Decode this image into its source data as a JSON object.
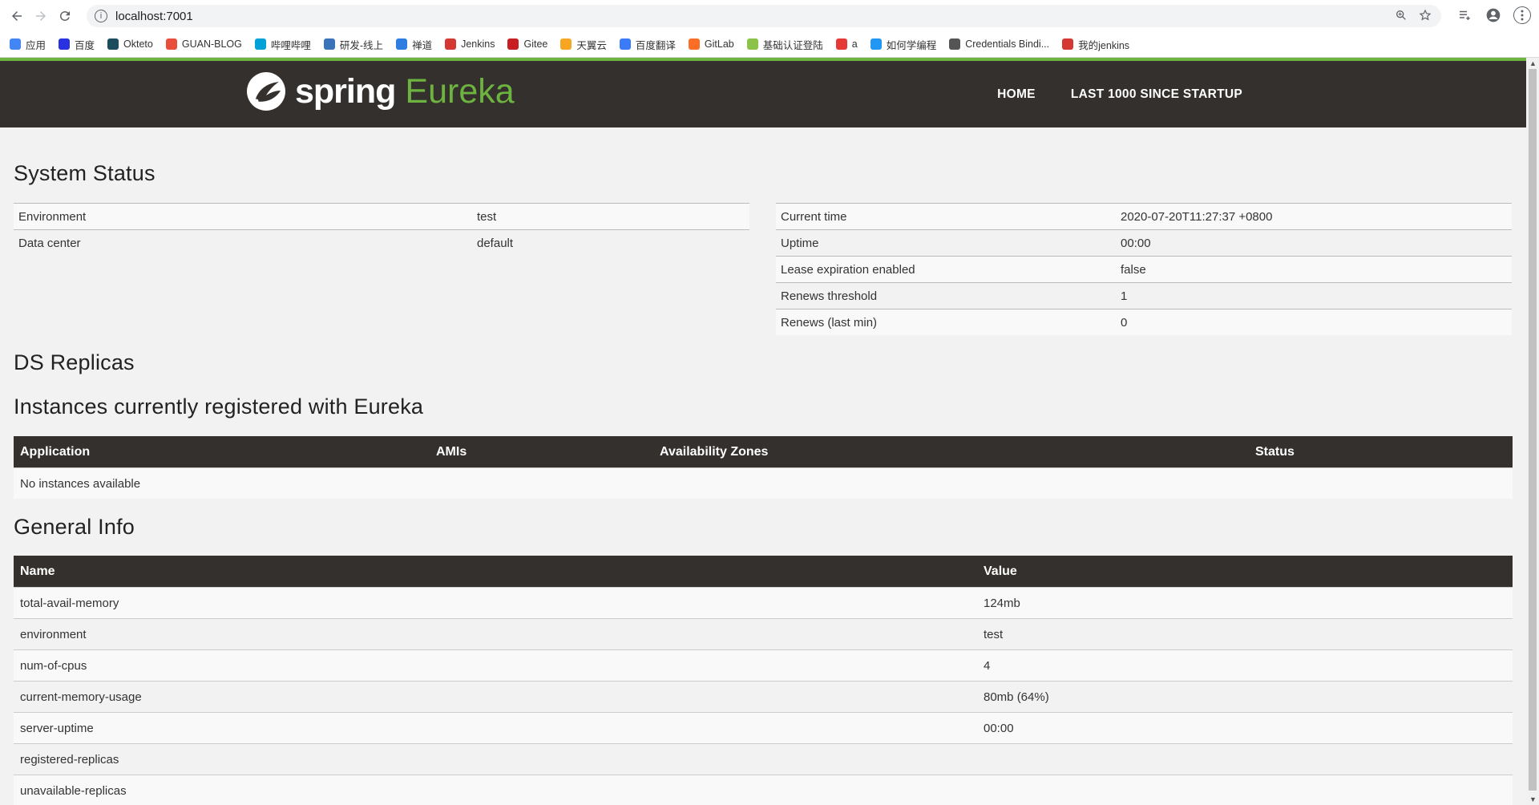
{
  "browser": {
    "url": "localhost:7001",
    "bookmarks": [
      {
        "label": "应用",
        "color": "#4285f4"
      },
      {
        "label": "百度",
        "color": "#2932e1"
      },
      {
        "label": "Okteto",
        "color": "#1b4d5c"
      },
      {
        "label": "GUAN-BLOG",
        "color": "#e94e3c"
      },
      {
        "label": "哔哩哔哩",
        "color": "#00a1d6"
      },
      {
        "label": "研发-线上",
        "color": "#3b73b9"
      },
      {
        "label": "禅道",
        "color": "#2e7de1"
      },
      {
        "label": "Jenkins",
        "color": "#d33833"
      },
      {
        "label": "Gitee",
        "color": "#c71d23"
      },
      {
        "label": "天翼云",
        "color": "#f6a623"
      },
      {
        "label": "百度翻译",
        "color": "#3b7bf7"
      },
      {
        "label": "GitLab",
        "color": "#fc6d26"
      },
      {
        "label": "基础认证登陆",
        "color": "#8bc34a"
      },
      {
        "label": "a",
        "color": "#e53935"
      },
      {
        "label": "如何学编程",
        "color": "#2196f3"
      },
      {
        "label": "Credentials Bindi...",
        "color": "#555555"
      },
      {
        "label": "我的jenkins",
        "color": "#d33833"
      }
    ]
  },
  "navbar": {
    "logo_word1": "spring",
    "logo_word2": "Eureka",
    "links": [
      "HOME",
      "LAST 1000 SINCE STARTUP"
    ]
  },
  "system_status": {
    "title": "System Status",
    "left": [
      {
        "name": "Environment",
        "value": "test"
      },
      {
        "name": "Data center",
        "value": "default"
      }
    ],
    "right": [
      {
        "name": "Current time",
        "value": "2020-07-20T11:27:37 +0800"
      },
      {
        "name": "Uptime",
        "value": "00:00"
      },
      {
        "name": "Lease expiration enabled",
        "value": "false"
      },
      {
        "name": "Renews threshold",
        "value": "1"
      },
      {
        "name": "Renews (last min)",
        "value": "0"
      }
    ]
  },
  "ds_replicas": {
    "title": "DS Replicas"
  },
  "instances": {
    "title": "Instances currently registered with Eureka",
    "headers": [
      "Application",
      "AMIs",
      "Availability Zones",
      "Status"
    ],
    "empty": "No instances available"
  },
  "general_info": {
    "title": "General Info",
    "headers": [
      "Name",
      "Value"
    ],
    "rows": [
      {
        "name": "total-avail-memory",
        "value": "124mb"
      },
      {
        "name": "environment",
        "value": "test"
      },
      {
        "name": "num-of-cpus",
        "value": "4"
      },
      {
        "name": "current-memory-usage",
        "value": "80mb (64%)"
      },
      {
        "name": "server-uptime",
        "value": "00:00"
      },
      {
        "name": "registered-replicas",
        "value": ""
      },
      {
        "name": "unavailable-replicas",
        "value": ""
      }
    ]
  },
  "colors": {
    "brand_green": "#6db33f",
    "navbar_bg": "#34302d"
  }
}
